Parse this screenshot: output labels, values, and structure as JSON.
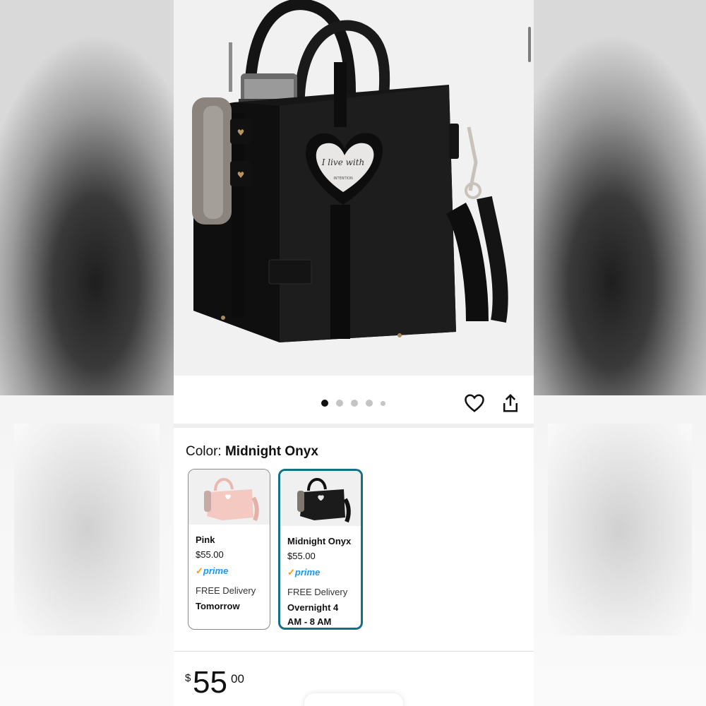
{
  "product": {
    "image_alt": "Black handbag with tumbler holder",
    "heart_tag_text": "I live with",
    "heart_tag_subtext": "INTENTION"
  },
  "gallery": {
    "dot_count": 5,
    "active_index": 0,
    "heart_icon": "heart-outline-icon",
    "share_icon": "share-icon"
  },
  "color": {
    "label": "Color:",
    "selected": "Midnight Onyx"
  },
  "swatches": [
    {
      "name": "Pink",
      "price": "$55.00",
      "prime": "prime",
      "delivery": "FREE Delivery",
      "when": "Tomorrow",
      "thumb_color": "#f3c9c2",
      "selected": false
    },
    {
      "name": "Midnight Onyx",
      "price": "$55.00",
      "prime": "prime",
      "delivery": "FREE Delivery",
      "when": "Overnight 4 AM - 8 AM",
      "thumb_color": "#1b1b1b",
      "selected": true
    }
  ],
  "price": {
    "symbol": "$",
    "whole": "55",
    "fraction": "00"
  },
  "colors": {
    "selected_border": "#127189",
    "prime_blue": "#1a98ff",
    "prime_check": "#ff9900"
  }
}
